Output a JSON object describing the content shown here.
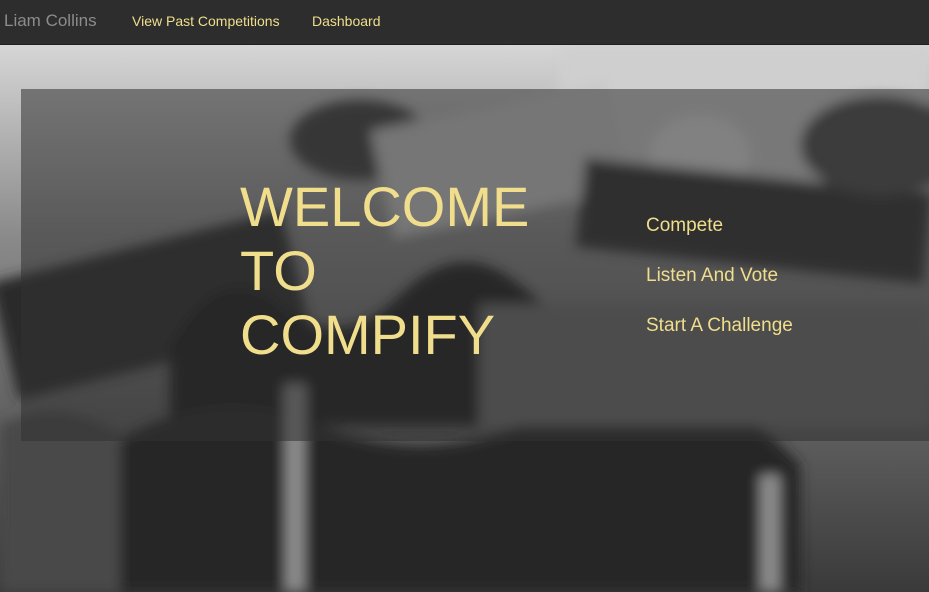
{
  "navbar": {
    "brand": "Liam Collins",
    "links": [
      {
        "label": "View Past Competitions"
      },
      {
        "label": "Dashboard"
      }
    ]
  },
  "hero": {
    "title_lines": [
      "WELCOME",
      "TO",
      "COMPIFY"
    ],
    "menu": [
      {
        "label": "Compete"
      },
      {
        "label": "Listen And Vote"
      },
      {
        "label": "Start A Challenge"
      }
    ]
  },
  "colors": {
    "accent": "#f0de8c",
    "navbar_bg": "#2d2d2d",
    "brand_text": "#8c8c8c"
  }
}
